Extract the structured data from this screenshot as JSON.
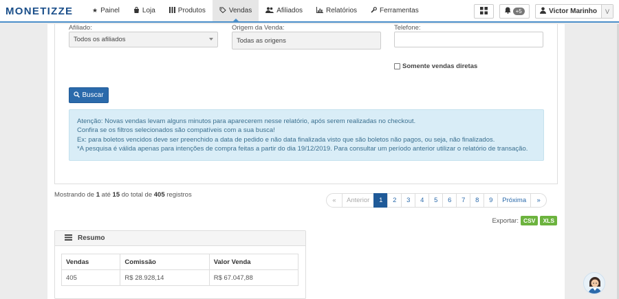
{
  "brand": {
    "logo": "MONETIZZE",
    "accent": "#1f5a98",
    "alert_bg": "#d9edf7"
  },
  "nav": [
    {
      "label": "Painel",
      "icon": "star-icon"
    },
    {
      "label": "Loja",
      "icon": "bag-icon"
    },
    {
      "label": "Produtos",
      "icon": "bars-icon"
    },
    {
      "label": "Vendas",
      "icon": "tag-icon",
      "active": true
    },
    {
      "label": "Afiliados",
      "icon": "users-icon"
    },
    {
      "label": "Relatórios",
      "icon": "chart-icon"
    },
    {
      "label": "Ferramentas",
      "icon": "wrench-icon"
    }
  ],
  "topbar": {
    "notifications_badge": "+5",
    "user_name": "Victor Marinho",
    "user_initial": "V"
  },
  "filters": {
    "affiliate_label": "Afiliado:",
    "affiliate_value": "Todos os afiliados",
    "origin_label": "Origem da Venda:",
    "origin_value": "Todas as origens",
    "phone_label": "Telefone:",
    "phone_value": "",
    "direct_sales_label": "Somente vendas diretas",
    "direct_sales_checked": false,
    "search_button": "Buscar"
  },
  "alert": {
    "lines": [
      "Atenção: Novas vendas levam alguns minutos para aparecerem nesse relatório, após serem realizadas no checkout.",
      "Confira se os filtros selecionados são compatíveis com a sua busca!",
      "Ex: para boletos vencidos deve ser preenchido a data de pedido e não data finalizada visto que são boletos não pagos, ou seja, não finalizados.",
      "*A pesquisa é válida apenas para intenções de compra feitas a partir do dia 19/12/2019. Para consultar um período anterior utilizar o relatório de transação."
    ]
  },
  "results": {
    "prefix": "Mostrando de",
    "from": "1",
    "mid": "até",
    "to": "15",
    "total_prefix": "do total de",
    "total": "405",
    "suffix": "registros"
  },
  "pagination": {
    "first": "«",
    "prev": "Anterior",
    "pages": [
      "1",
      "2",
      "3",
      "4",
      "5",
      "6",
      "7",
      "8",
      "9"
    ],
    "active_page": "1",
    "next": "Próxima",
    "last": "»"
  },
  "export": {
    "label": "Exportar:",
    "csv": "CSV",
    "xls": "XLS"
  },
  "summary": {
    "title": "Resumo",
    "headers": [
      "Vendas",
      "Comissão",
      "Valor Venda"
    ],
    "row": [
      "405",
      "R$ 28.928,14",
      "R$ 67.047,88"
    ]
  }
}
